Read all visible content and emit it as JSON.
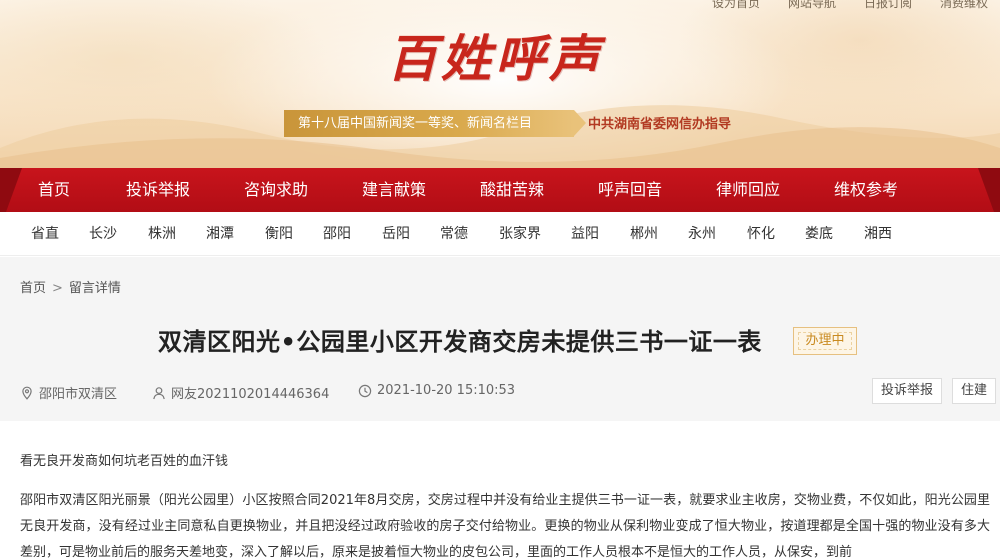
{
  "top_links": [
    "设为首页",
    "网站导航",
    "日报订阅",
    "消费维权"
  ],
  "logo_text": "百姓呼声",
  "award_label": "第十八届中国新闻奖一等奖、新闻名栏目",
  "guide_label": "中共湖南省委网信办指导",
  "main_nav": [
    "首页",
    "投诉举报",
    "咨询求助",
    "建言献策",
    "酸甜苦辣",
    "呼声回音",
    "律师回应",
    "维权参考"
  ],
  "city_nav": [
    "省直",
    "长沙",
    "株洲",
    "湘潭",
    "衡阳",
    "邵阳",
    "岳阳",
    "常德",
    "张家界",
    "益阳",
    "郴州",
    "永州",
    "怀化",
    "娄底",
    "湘西"
  ],
  "breadcrumb": {
    "home": "首页",
    "separator": ">",
    "current": "留言详情"
  },
  "post": {
    "title": "双清区阳光•公园里小区开发商交房未提供三书一证一表",
    "status": "办理中",
    "location": "邵阳市双清区",
    "author": "网友2021102014446364",
    "time": "2021-10-20 15:10:53",
    "actions": {
      "report": "投诉举报",
      "reply": "住建"
    },
    "lead": "看无良开发商如何坑老百姓的血汗钱",
    "body": "邵阳市双清区阳光丽景（阳光公园里）小区按照合同2021年8月交房，交房过程中并没有给业主提供三书一证一表，就要求业主收房，交物业费，不仅如此，阳光公园里无良开发商，没有经过业主同意私自更换物业，并且把没经过政府验收的房子交付给物业。更换的物业从保利物业变成了恒大物业，按道理都是全国十强的物业没有多大差别，可是物业前后的服务天差地变，深入了解以后，原来是披着恒大物业的皮包公司，里面的工作人员根本不是恒大的工作人员，从保安，到前"
  },
  "colors": {
    "nav_red": "#c8141c",
    "logo_red": "#c8261c",
    "award_gold": "#d9a94c",
    "status_orange": "#c98a20"
  },
  "icons": [
    "location-icon",
    "user-icon",
    "clock-icon"
  ]
}
